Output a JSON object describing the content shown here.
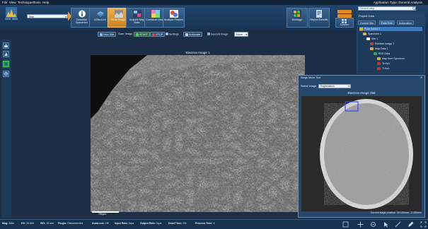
{
  "menu": [
    "File",
    "View",
    "Techniques",
    "Tools",
    "Help"
  ],
  "app_type": "Application Type: General Analysis",
  "ribbon": {
    "eds_label": "EDS SEM",
    "site_value": "Map",
    "steps": [
      {
        "label": "Describe Specimen",
        "icon": "info-icon",
        "color": "#ffffff"
      },
      {
        "label": "AZtecLive",
        "icon": "layers-icon",
        "color": "#7fb2e5"
      },
      {
        "label": "Scan Image",
        "icon": "electron-image-icon",
        "color": "#c9c9c9"
      },
      {
        "label": "Acquire Map Data",
        "icon": "map-acquire-icon",
        "color": "#6fd0f0"
      },
      {
        "label": "Construct Maps",
        "icon": "construct-maps-icon",
        "color": "#f07fb0"
      },
      {
        "label": "Analyze Phases",
        "icon": "analyze-phases-icon",
        "color": "#e04a4a"
      }
    ],
    "tools": [
      {
        "label": "Montage",
        "icon": "montage-icon",
        "color": "#e0a030"
      },
      {
        "label": "Report Results",
        "icon": "report-icon",
        "color": "#c0d8f0"
      }
    ],
    "search_placeholder": "Search step",
    "custom_label": "Custom"
  },
  "toolbar": {
    "new_site": "New Site",
    "scan_image_label": "Scan Image",
    "start": "START",
    "stop": "STOP",
    "settings": "Settings",
    "automate": "Automate",
    "second_image_label": "Second Image",
    "second_image_value": "None"
  },
  "main_image": {
    "title": "Electron Image 1",
    "scale": "750µm"
  },
  "stage_tool": {
    "title": "Stage Move Tool",
    "select_label": "Select Image:",
    "select_value": "Registrations",
    "image_title": "Electron Image 258",
    "position": "Current stage position: 20.150mm, -2.450mm"
  },
  "project": {
    "title": "Project Data",
    "tabs": [
      "Current Site",
      "Data Tree",
      "Automation"
    ],
    "tree": [
      {
        "label": "Plain Select 1",
        "level": 0,
        "icon": "folder-icon",
        "color": "#e0b040",
        "selected": true
      },
      {
        "label": "Specimen 1",
        "level": 1,
        "icon": "specimen-icon",
        "color": "#e0b040"
      },
      {
        "label": "Site 1",
        "level": 2,
        "icon": "site-icon",
        "color": "#ffffff"
      },
      {
        "label": "Electron Image 1",
        "level": 3,
        "icon": "image-icon",
        "color": "#c04040"
      },
      {
        "label": "Map Data 1",
        "level": 3,
        "icon": "map-data-icon",
        "color": "#e0b040"
      },
      {
        "label": "EDS Data",
        "level": 4,
        "icon": "eds-data-icon",
        "color": "#40a060"
      },
      {
        "label": "Map Sum Spectrum",
        "level": 5,
        "icon": "spectrum-icon",
        "color": "#e0b040"
      },
      {
        "label": "Te Ka1",
        "level": 5,
        "icon": "element-map-icon",
        "color": "#d03030"
      },
      {
        "label": "Ti Ka1",
        "level": 5,
        "icon": "element-map-icon",
        "color": "#d03030"
      }
    ]
  },
  "status": {
    "mag_label": "Mag:",
    "mag": "386x",
    "hv_label": "HV:",
    "hv": "20.0kV",
    "wd_label": "WD:",
    "wd": "15 mm",
    "plugin_label": "Plugin:",
    "plugin": "Disconnected",
    "autolock_label": "AutoLock:",
    "autolock": "Off",
    "input_label": "Input Rate:",
    "input": "0cps",
    "output_label": "Output Rate:",
    "output": "0cps",
    "dead_label": "Dead Time:",
    "dead": "0%",
    "process_label": "Process Time:",
    "process": "4"
  }
}
